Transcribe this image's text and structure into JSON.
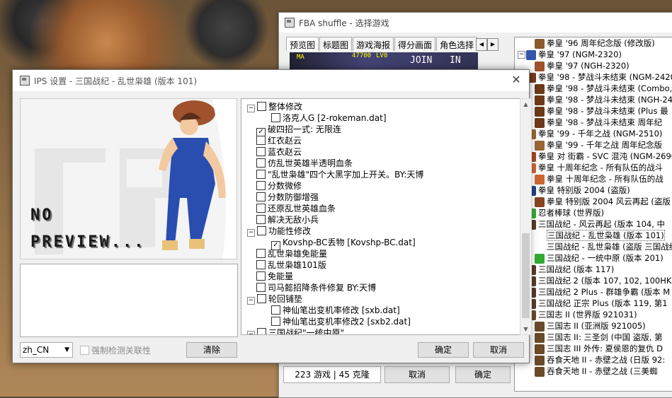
{
  "main_window": {
    "title": "FBA shuffle - 选择游戏",
    "tabs": [
      "预览图",
      "标题图",
      "游戏海报",
      "得分画面",
      "角色选择"
    ],
    "hud": {
      "score": "47700",
      "level": "LV0",
      "join": "JOIN",
      "in": "IN",
      "player": "MA"
    },
    "status": "223 游戏 | 45 克隆",
    "cancel_label": "取消",
    "ok_label": "确定",
    "game_list": [
      {
        "text": "拳皇 '96 周年纪念版 (修改版)",
        "indent": 28,
        "icon": "#8b5a2b"
      },
      {
        "text": "拳皇 '97 (NGM-2320)",
        "indent": 16,
        "icon": "#3355aa",
        "expander": "minus"
      },
      {
        "text": "拳皇 '97 (NGH-2320)",
        "indent": 28,
        "icon": "#a0522d"
      },
      {
        "text": "拳皇 '98 - 梦战斗未结束 (NGM-2420",
        "indent": 16,
        "icon": "#7a3c1e"
      },
      {
        "text": "拳皇 '98 - 梦战斗未结束 (Combo,",
        "indent": 28,
        "icon": "#6b3a1a"
      },
      {
        "text": "拳皇 '98 - 梦战斗未结束 (NGH-24",
        "indent": 28,
        "icon": "#6b3a1a"
      },
      {
        "text": "拳皇 '98 - 梦战斗未结束 (Plus 最",
        "indent": 28,
        "icon": "#6b3a1a"
      },
      {
        "text": "拳皇 '98 - 梦战斗未结束 周年纪",
        "indent": 28,
        "icon": "#6b3a1a"
      },
      {
        "text": "拳皇 '99 - 千年之战 (NGM-2510)",
        "indent": 16,
        "icon": "#996633"
      },
      {
        "text": "拳皇 '99 - 千年之战 周年纪念版",
        "indent": 28,
        "icon": "#996633"
      },
      {
        "text": "拳皇 对 街霸 - SVC 混沌 (NGM-2690",
        "indent": 16,
        "icon": "#aa4422"
      },
      {
        "text": "拳皇 十周年纪念 - 所有队伍的战斗",
        "indent": 16,
        "icon": "#cc6633"
      },
      {
        "text": "拳皇 十周年纪念 - 所有队伍的战",
        "indent": 28,
        "icon": "#cc6633"
      },
      {
        "text": "拳皇 特别版 2004 (盗版)",
        "indent": 16,
        "icon": "#224488"
      },
      {
        "text": "拳皇 特别版 2004 风云再起 (盗版",
        "indent": 28,
        "icon": "#884422"
      },
      {
        "text": "忍者棒球 (世界版)",
        "indent": 16,
        "icon": "#33aa33"
      },
      {
        "text": "三国战纪 - 风云再起 (版本 104, 中",
        "indent": 16,
        "icon": "#5a3a2a"
      },
      {
        "text": "三国战纪 - 乱世枭雄 (版本 101)",
        "indent": 28,
        "icon": "#ffffff",
        "selected": true
      },
      {
        "text": "三国战纪 - 乱世枭雄 (盗版 三国战纪 - 乱世",
        "indent": 28,
        "icon": "#ffffff"
      },
      {
        "text": "三国战纪 - 一统中原 (版本 201)",
        "indent": 28,
        "icon": "#33aa33"
      },
      {
        "text": "三国战纪 (版本 117)",
        "indent": 16,
        "icon": "#5a3a2a"
      },
      {
        "text": "三国战纪 2 (版本 107, 102, 100HK)",
        "indent": 16,
        "icon": "#5a3a2a"
      },
      {
        "text": "三国战纪 2 Plus - 群雄争霸 (版本 M",
        "indent": 16,
        "icon": "#5a3a2a"
      },
      {
        "text": "三国战纪 正宗 Plus (版本 119, 第1",
        "indent": 16,
        "icon": "#5a3a2a"
      },
      {
        "text": "三国志 II (世界版 921031)",
        "indent": 16,
        "icon": "#6a4a2a"
      },
      {
        "text": "三国志 II (亚洲版 921005)",
        "indent": 28,
        "icon": "#6a4a2a"
      },
      {
        "text": "三国志 II: 三圣剑 (中国 盗版, 第",
        "indent": 28,
        "icon": "#6a4a2a"
      },
      {
        "text": "三国志 III 外传: 夏侯恩的复仇 D",
        "indent": 28,
        "icon": "#6a4a2a"
      },
      {
        "text": "吞食天地 II - 赤壁之战 (日版 92:",
        "indent": 28,
        "icon": "#6a4a2a"
      },
      {
        "text": "吞食天地 II - 赤壁之战 (三美蜘",
        "indent": 28,
        "icon": "#6a4a2a"
      }
    ]
  },
  "ips_dialog": {
    "title": "IPS 设置 - 三国战纪 - 乱世枭雄 (版本 101)",
    "preview_text_line1": "NO",
    "preview_text_line2": "PREVIEW...",
    "tree": [
      {
        "text": "整体修改",
        "level": 0,
        "expander": "minus",
        "checked": false
      },
      {
        "text": "洛克人G [2-rokeman.dat]",
        "level": 1,
        "checked": false
      },
      {
        "text": "破四招一式: 无限连",
        "level": 0,
        "checked": true
      },
      {
        "text": "红衣赵云",
        "level": 0,
        "checked": false
      },
      {
        "text": "蓝衣赵云",
        "level": 0,
        "checked": false
      },
      {
        "text": "仿乱世英雄半透明血条",
        "level": 0,
        "checked": false
      },
      {
        "text": "\"乱世枭雄\"四个大黑字加上开关。BY:天博",
        "level": 0,
        "checked": false
      },
      {
        "text": "分数微修",
        "level": 0,
        "checked": false
      },
      {
        "text": "分数防御增强",
        "level": 0,
        "checked": false
      },
      {
        "text": "还原乱世英雄血条",
        "level": 0,
        "checked": false
      },
      {
        "text": "解决无敌小兵",
        "level": 0,
        "checked": false
      },
      {
        "text": "功能性修改",
        "level": 0,
        "expander": "minus",
        "checked": false
      },
      {
        "text": "Kovshp-BC丢物 [Kovshp-BC.dat]",
        "level": 1,
        "checked": true
      },
      {
        "text": "乱世枭雄免能量",
        "level": 0,
        "checked": false
      },
      {
        "text": "乱世枭雄101版",
        "level": 0,
        "checked": false
      },
      {
        "text": "免能量",
        "level": 0,
        "checked": false
      },
      {
        "text": "司马懿招降条件修复 BY:天博",
        "level": 0,
        "checked": false
      },
      {
        "text": "轮回铺垫",
        "level": 0,
        "expander": "minus",
        "checked": false
      },
      {
        "text": "神仙笔出变机率修改 [sxb.dat]",
        "level": 1,
        "checked": false
      },
      {
        "text": "神仙笔出变机率修改2 [sxb2.dat]",
        "level": 1,
        "checked": false
      },
      {
        "text": "三国战纪\"一统中原\"",
        "level": 0,
        "expander": "minus",
        "checked": false
      }
    ],
    "language": "zh_CN",
    "force_check_label": "强制检测关联性",
    "clear_label": "清除",
    "ok_label": "确定",
    "cancel_label": "取消"
  }
}
